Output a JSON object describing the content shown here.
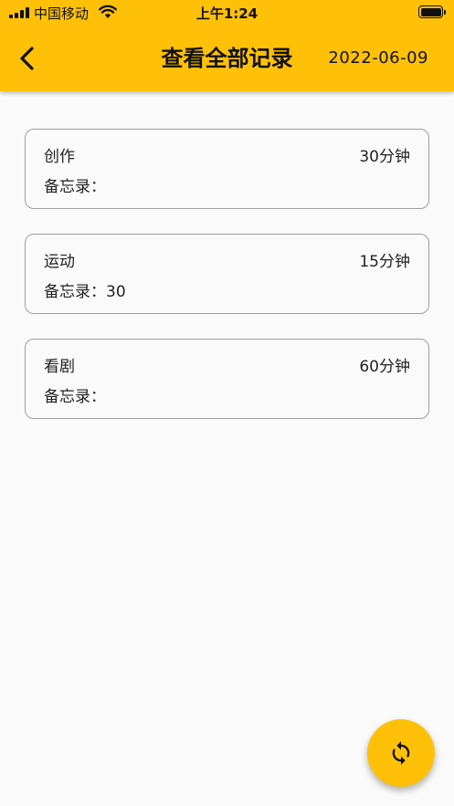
{
  "status_bar": {
    "carrier": "中国移动",
    "time": "上午1:24"
  },
  "header": {
    "title": "查看全部记录",
    "date": "2022-06-09",
    "back_icon": "chevron-left-icon",
    "background_color": "#FFC107"
  },
  "memo_label": "备忘录：",
  "records": [
    {
      "name": "创作",
      "duration": "30分钟",
      "memo": ""
    },
    {
      "name": "运动",
      "duration": "15分钟",
      "memo": "30"
    },
    {
      "name": "看剧",
      "duration": "60分钟",
      "memo": ""
    }
  ],
  "fab": {
    "icon": "refresh-icon",
    "color": "#FFC107"
  }
}
